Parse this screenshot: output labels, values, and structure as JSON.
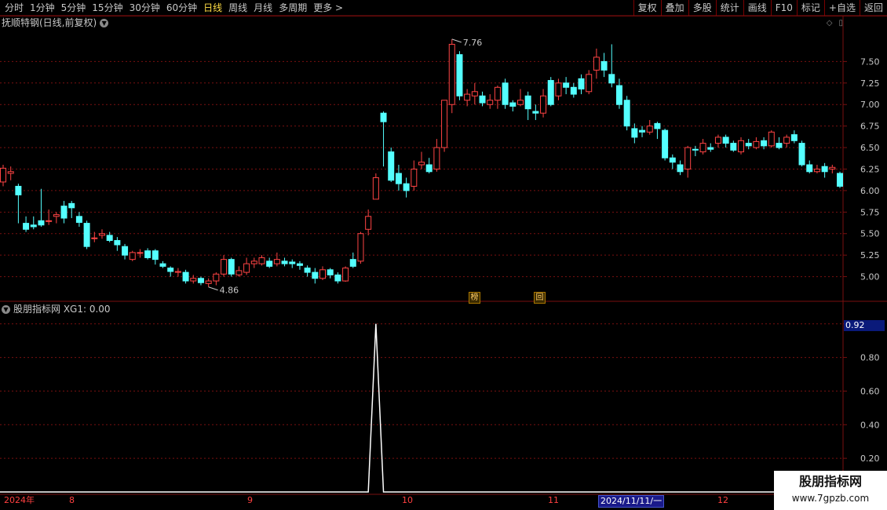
{
  "toolbar": {
    "periods": [
      "分时",
      "1分钟",
      "5分钟",
      "15分钟",
      "30分钟",
      "60分钟",
      "日线",
      "周线",
      "月线",
      "多周期",
      "更多 >"
    ],
    "active_period": "日线",
    "right_buttons": [
      "复权",
      "叠加",
      "多股",
      "统计",
      "画线",
      "F10",
      "标记",
      "+自选",
      "返回"
    ]
  },
  "chart_title": "抚顺特钢(日线,前复权)",
  "indicator_title": "股朋指标网 XG1: 0.00",
  "current_value_box": "0.92",
  "tags": [
    "榜",
    "回"
  ],
  "timeline": {
    "labels": [
      "2024年",
      "8",
      "9",
      "10",
      "11",
      "12"
    ],
    "selected_date": "2024/11/11/一"
  },
  "watermark": {
    "line1": "股朋指标网",
    "line2": "www.7gpzb.com"
  },
  "colors": {
    "up": "#ff4444",
    "down": "#54ffff",
    "grid": "#7a1010",
    "bg": "#000000",
    "axis_text": "#c8c8c8"
  },
  "chart_data": [
    {
      "type": "candlestick",
      "ylim": [
        4.75,
        7.85
      ],
      "y_ticks": [
        "7.50",
        "7.25",
        "7.00",
        "6.75",
        "6.50",
        "6.25",
        "6.00",
        "5.75",
        "5.50",
        "5.25",
        "5.00"
      ],
      "annotations": [
        {
          "text": "7.76"
        },
        {
          "text": "4.86"
        }
      ],
      "ohlc": [
        [
          6.1,
          6.26,
          6.3,
          6.05
        ],
        [
          6.2,
          6.22,
          6.28,
          6.12
        ],
        [
          6.05,
          5.95,
          6.08,
          5.62
        ],
        [
          5.62,
          5.55,
          5.7,
          5.52
        ],
        [
          5.6,
          5.58,
          5.7,
          5.55
        ],
        [
          5.65,
          5.6,
          6.02,
          5.58
        ],
        [
          5.65,
          5.65,
          5.78,
          5.6
        ],
        [
          5.7,
          5.72,
          5.75,
          5.62
        ],
        [
          5.82,
          5.68,
          5.88,
          5.62
        ],
        [
          5.85,
          5.8,
          5.88,
          5.68
        ],
        [
          5.7,
          5.63,
          5.75,
          5.58
        ],
        [
          5.62,
          5.35,
          5.65,
          5.32
        ],
        [
          5.45,
          5.45,
          5.52,
          5.4
        ],
        [
          5.48,
          5.5,
          5.55,
          5.44
        ],
        [
          5.48,
          5.42,
          5.52,
          5.4
        ],
        [
          5.42,
          5.37,
          5.46,
          5.3
        ],
        [
          5.35,
          5.25,
          5.38,
          5.2
        ],
        [
          5.2,
          5.28,
          5.3,
          5.18
        ],
        [
          5.28,
          5.28,
          5.32,
          5.22
        ],
        [
          5.3,
          5.22,
          5.33,
          5.2
        ],
        [
          5.3,
          5.2,
          5.32,
          5.14
        ],
        [
          5.15,
          5.12,
          5.18,
          5.1
        ],
        [
          5.1,
          5.06,
          5.12,
          5.0
        ],
        [
          5.05,
          5.06,
          5.1,
          5.0
        ],
        [
          5.05,
          4.95,
          5.08,
          4.92
        ],
        [
          4.95,
          4.98,
          5.02,
          4.92
        ],
        [
          4.98,
          4.93,
          5.0,
          4.9
        ],
        [
          4.92,
          4.95,
          4.98,
          4.88
        ],
        [
          4.95,
          5.03,
          5.05,
          4.9
        ],
        [
          5.03,
          5.2,
          5.25,
          5.0
        ],
        [
          5.2,
          5.03,
          5.22,
          5.0
        ],
        [
          5.02,
          5.07,
          5.12,
          5.0
        ],
        [
          5.05,
          5.15,
          5.22,
          5.02
        ],
        [
          5.15,
          5.18,
          5.22,
          5.1
        ],
        [
          5.15,
          5.22,
          5.25,
          5.13
        ],
        [
          5.18,
          5.12,
          5.22,
          5.1
        ],
        [
          5.15,
          5.2,
          5.28,
          5.12
        ],
        [
          5.18,
          5.15,
          5.22,
          5.12
        ],
        [
          5.17,
          5.15,
          5.2,
          5.1
        ],
        [
          5.15,
          5.13,
          5.18,
          5.08
        ],
        [
          5.1,
          5.05,
          5.13,
          5.0
        ],
        [
          5.05,
          4.98,
          5.1,
          4.92
        ],
        [
          4.98,
          5.08,
          5.12,
          4.96
        ],
        [
          5.08,
          5.02,
          5.1,
          4.98
        ],
        [
          5.02,
          4.95,
          5.05,
          4.92
        ],
        [
          4.95,
          5.1,
          5.12,
          4.94
        ],
        [
          5.2,
          5.12,
          5.28,
          5.1
        ],
        [
          5.18,
          5.5,
          5.52,
          5.15
        ],
        [
          5.55,
          5.7,
          5.78,
          5.48
        ],
        [
          5.9,
          6.15,
          6.2,
          6.0
        ],
        [
          6.9,
          6.8,
          6.92,
          6.28
        ],
        [
          6.45,
          6.12,
          6.5,
          6.1
        ],
        [
          6.2,
          6.08,
          6.3,
          6.0
        ],
        [
          6.08,
          6.0,
          6.15,
          5.92
        ],
        [
          6.05,
          6.25,
          6.35,
          6.0
        ],
        [
          6.3,
          6.33,
          6.45,
          6.25
        ],
        [
          6.3,
          6.22,
          6.38,
          6.2
        ],
        [
          6.25,
          6.5,
          6.6,
          6.22
        ],
        [
          6.5,
          7.05,
          7.05,
          6.45
        ],
        [
          7.0,
          7.7,
          7.76,
          6.9
        ],
        [
          7.58,
          7.1,
          7.62,
          7.05
        ],
        [
          7.05,
          7.12,
          7.18,
          6.98
        ],
        [
          7.1,
          7.15,
          7.25,
          7.0
        ],
        [
          7.1,
          7.02,
          7.15,
          6.98
        ],
        [
          7.0,
          7.05,
          7.12,
          6.95
        ],
        [
          7.05,
          7.2,
          7.22,
          6.95
        ],
        [
          7.25,
          7.0,
          7.3,
          6.95
        ],
        [
          7.02,
          6.98,
          7.05,
          6.92
        ],
        [
          7.0,
          7.05,
          7.18,
          6.98
        ],
        [
          7.1,
          6.95,
          7.15,
          6.82
        ],
        [
          6.92,
          6.9,
          7.0,
          6.82
        ],
        [
          6.9,
          7.1,
          7.18,
          6.85
        ],
        [
          7.28,
          7.0,
          7.32,
          6.98
        ],
        [
          7.1,
          7.25,
          7.3,
          7.05
        ],
        [
          7.25,
          7.2,
          7.32,
          7.12
        ],
        [
          7.2,
          7.12,
          7.25,
          7.08
        ],
        [
          7.3,
          7.18,
          7.35,
          7.12
        ],
        [
          7.15,
          7.35,
          7.4,
          7.12
        ],
        [
          7.4,
          7.55,
          7.65,
          7.3
        ],
        [
          7.5,
          7.4,
          7.6,
          7.32
        ],
        [
          7.35,
          7.25,
          7.7,
          7.2
        ],
        [
          7.22,
          7.0,
          7.3,
          6.95
        ],
        [
          7.05,
          6.75,
          7.1,
          6.7
        ],
        [
          6.72,
          6.62,
          6.78,
          6.55
        ],
        [
          6.7,
          6.68,
          6.75,
          6.62
        ],
        [
          6.68,
          6.75,
          6.82,
          6.65
        ],
        [
          6.78,
          6.72,
          6.8,
          6.6
        ],
        [
          6.7,
          6.38,
          6.72,
          6.35
        ],
        [
          6.38,
          6.33,
          6.42,
          6.25
        ],
        [
          6.3,
          6.22,
          6.35,
          6.18
        ],
        [
          6.25,
          6.5,
          6.52,
          6.15
        ],
        [
          6.48,
          6.47,
          6.52,
          6.4
        ],
        [
          6.45,
          6.55,
          6.6,
          6.42
        ],
        [
          6.5,
          6.48,
          6.55,
          6.45
        ],
        [
          6.55,
          6.62,
          6.65,
          6.5
        ],
        [
          6.62,
          6.55,
          6.65,
          6.5
        ],
        [
          6.55,
          6.47,
          6.58,
          6.45
        ],
        [
          6.45,
          6.58,
          6.62,
          6.42
        ],
        [
          6.55,
          6.52,
          6.6,
          6.48
        ],
        [
          6.5,
          6.57,
          6.62,
          6.48
        ],
        [
          6.58,
          6.52,
          6.62,
          6.48
        ],
        [
          6.52,
          6.68,
          6.7,
          6.5
        ],
        [
          6.55,
          6.5,
          6.62,
          6.48
        ],
        [
          6.55,
          6.62,
          6.65,
          6.5
        ],
        [
          6.65,
          6.58,
          6.7,
          6.55
        ],
        [
          6.55,
          6.3,
          6.58,
          6.28
        ],
        [
          6.3,
          6.22,
          6.35,
          6.2
        ],
        [
          6.22,
          6.25,
          6.3,
          6.2
        ],
        [
          6.28,
          6.22,
          6.32,
          6.15
        ],
        [
          6.25,
          6.27,
          6.3,
          6.2
        ],
        [
          6.2,
          6.05,
          6.22,
          6.03
        ]
      ]
    },
    {
      "type": "line",
      "title": "XG1",
      "ylim": [
        0.0,
        1.05
      ],
      "y_ticks": [
        "1.00",
        "0.80",
        "0.60",
        "0.40",
        "0.20"
      ],
      "signal_bar_index": 49,
      "signal_value": 1.0
    }
  ]
}
